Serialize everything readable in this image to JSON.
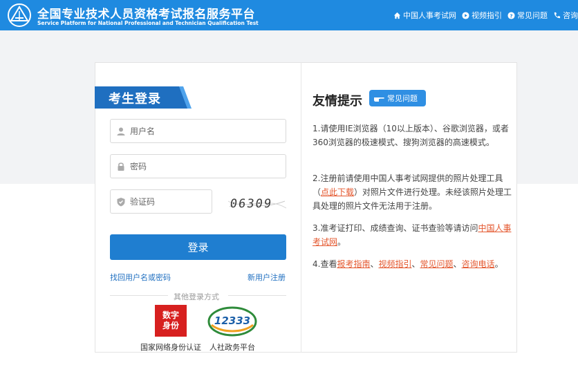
{
  "header": {
    "title_cn": "全国专业技术人员资格考试报名服务平台",
    "title_en": "Service Platform for National Professional and Technician Qualification Test",
    "nav": [
      {
        "label": "中国人事考试网",
        "icon": "home-icon"
      },
      {
        "label": "视频指引",
        "icon": "play-icon"
      },
      {
        "label": "常见问题",
        "icon": "question-icon"
      },
      {
        "label": "咨询",
        "icon": "phone-icon"
      }
    ]
  },
  "login": {
    "tab_label": "考生登录",
    "username_placeholder": "用户名",
    "password_placeholder": "密码",
    "captcha_placeholder": "验证码",
    "captcha_text": "06309",
    "submit_label": "登录",
    "forgot_label": "找回用户名或密码",
    "register_label": "新用户注册",
    "other_methods_label": "其他登录方式",
    "methods": [
      {
        "label": "国家网络身份认证",
        "logo_text_1": "数字",
        "logo_text_2": "身份",
        "icon": "digital-id-icon"
      },
      {
        "label": "人社政务平台",
        "logo_text": "12333",
        "icon": "12333-icon"
      }
    ]
  },
  "tips": {
    "title": "友情提示",
    "faq_badge": "常见问题",
    "tip1": "1.请使用IE浏览器（10以上版本）、谷歌浏览器，或者360浏览器的极速模式、搜狗浏览器的高速模式。",
    "tip2_a": "2.注册前请使用中国人事考试网提供的照片处理工具（",
    "tip2_link": "点此下载",
    "tip2_b": "）对照片文件进行处理。未经该照片处理工具处理的照片文件无法用于注册。",
    "tip3_a": "3.准考证打印、成绩查询、证书查验等请访问",
    "tip3_link": "中国人事考试网",
    "tip3_b": "。",
    "tip4_a": "4.查看",
    "tip4_link1": "报考指南",
    "tip4_sep1": "、",
    "tip4_link2": "视频指引",
    "tip4_sep2": "、",
    "tip4_link3": "常见问题",
    "tip4_sep3": "、",
    "tip4_link4": "咨询电话",
    "tip4_b": "。"
  },
  "colors": {
    "header_bg": "#1f8ae0",
    "primary": "#1f7ed0",
    "link": "#1f6fc0",
    "highlight_link": "#e4572e",
    "digital_id_red": "#d7201f"
  }
}
